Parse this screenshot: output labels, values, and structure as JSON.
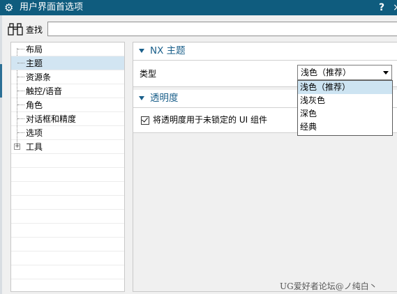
{
  "window": {
    "title": "用户界面首选项",
    "gear_icon": "gear-icon",
    "help_label": "?",
    "close_label": "×",
    "title_bg": "#0f5c7e"
  },
  "search": {
    "label": "查找",
    "value": "",
    "icon": "binoculars-icon"
  },
  "tree": {
    "items": [
      {
        "label": "布局",
        "selected": false,
        "expandable": false
      },
      {
        "label": "主题",
        "selected": true,
        "expandable": false
      },
      {
        "label": "资源条",
        "selected": false,
        "expandable": false
      },
      {
        "label": "触控/语音",
        "selected": false,
        "expandable": false
      },
      {
        "label": "角色",
        "selected": false,
        "expandable": false
      },
      {
        "label": "对话框和精度",
        "selected": false,
        "expandable": false
      },
      {
        "label": "选项",
        "selected": false,
        "expandable": false
      },
      {
        "label": "工具",
        "selected": false,
        "expandable": true
      }
    ],
    "expand_glyph": "+",
    "selected_color": "#d2e5f2"
  },
  "sections": {
    "theme": {
      "title": "NX 主题",
      "type_label": "类型",
      "type_value": "浅色（推荐）"
    },
    "transparency": {
      "title": "透明度",
      "checkbox_label": "将透明度用于未锁定的 UI 组件",
      "checked": true
    }
  },
  "dropdown": {
    "options": [
      "浅色（推荐）",
      "浅灰色",
      "深色",
      "经典"
    ],
    "highlighted_index": 0
  },
  "watermark": "UG爱好者论坛@ノ纯白丶"
}
